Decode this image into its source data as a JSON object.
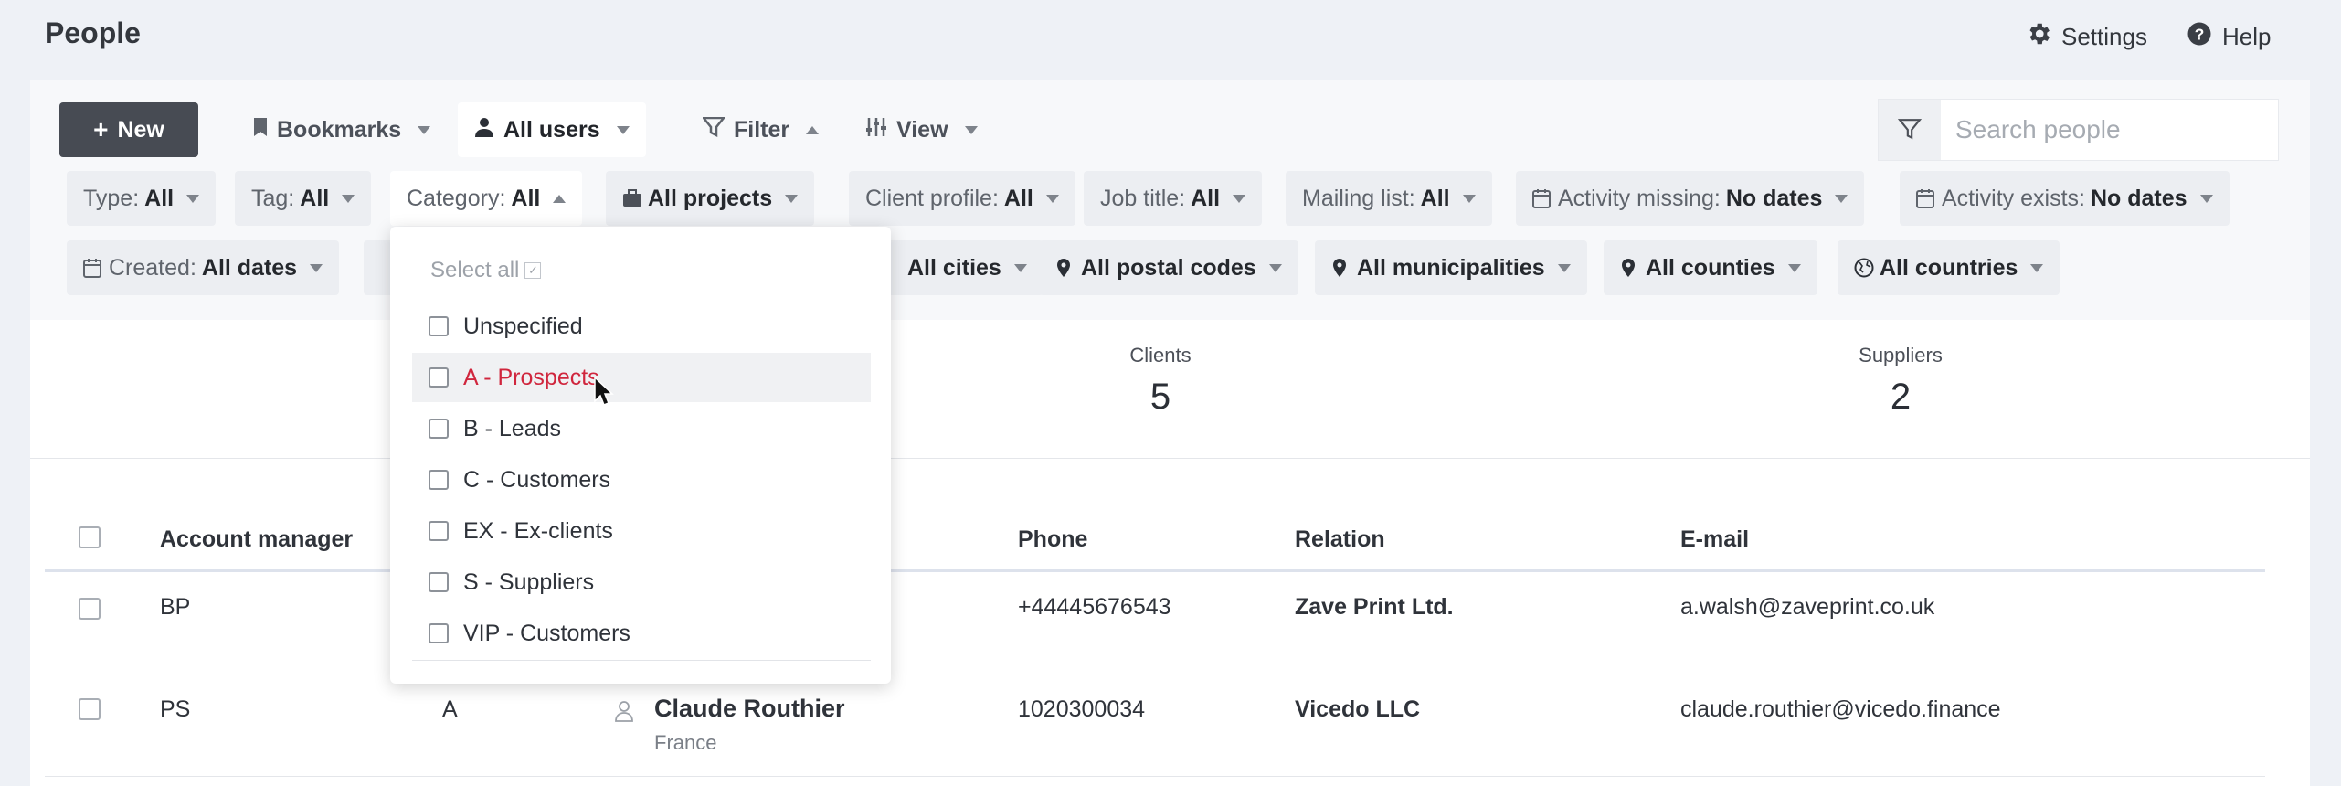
{
  "header": {
    "title": "People",
    "settings_label": "Settings",
    "help_label": "Help"
  },
  "toolbar": {
    "new_label": "New",
    "bookmarks_label": "Bookmarks",
    "users_label": "All users",
    "filter_label": "Filter",
    "view_label": "View",
    "search_placeholder": "Search people"
  },
  "filters": {
    "type": {
      "label": "Type:",
      "value": "All"
    },
    "tag": {
      "label": "Tag:",
      "value": "All"
    },
    "category": {
      "label": "Category:",
      "value": "All"
    },
    "projects": {
      "value": "All projects"
    },
    "client_profile": {
      "label": "Client profile:",
      "value": "All"
    },
    "job_title": {
      "label": "Job title:",
      "value": "All"
    },
    "mailing_list": {
      "label": "Mailing list:",
      "value": "All"
    },
    "activity_missing": {
      "label": "Activity missing:",
      "value": "No dates"
    },
    "activity_exists": {
      "label": "Activity exists:",
      "value": "No dates"
    },
    "created": {
      "label": "Created:",
      "value": "All dates"
    },
    "cities": {
      "value": "All cities"
    },
    "postal_codes": {
      "value": "All postal codes"
    },
    "municipalities": {
      "value": "All municipalities"
    },
    "counties": {
      "value": "All counties"
    },
    "countries": {
      "value": "All countries"
    }
  },
  "category_dropdown": {
    "select_all": "Select all",
    "options": [
      "Unspecified",
      "A - Prospects",
      "B - Leads",
      "C - Customers",
      "EX - Ex-clients",
      "S - Suppliers",
      "VIP - Customers"
    ]
  },
  "stats": {
    "clients": {
      "label": "Clients",
      "value": "5"
    },
    "suppliers": {
      "label": "Suppliers",
      "value": "2"
    }
  },
  "table": {
    "headers": {
      "account_manager": "Account manager",
      "phone": "Phone",
      "relation": "Relation",
      "email": "E-mail"
    },
    "rows": [
      {
        "manager": "BP",
        "category": "",
        "name": "",
        "sub": "",
        "phone": "+44445676543",
        "relation": "Zave Print Ltd.",
        "email": "a.walsh@zaveprint.co.uk"
      },
      {
        "manager": "PS",
        "category": "A",
        "name": "Claude Routhier",
        "sub": "France",
        "phone": "1020300034",
        "relation": "Vicedo LLC",
        "email": "claude.routhier@vicedo.finance"
      }
    ]
  }
}
